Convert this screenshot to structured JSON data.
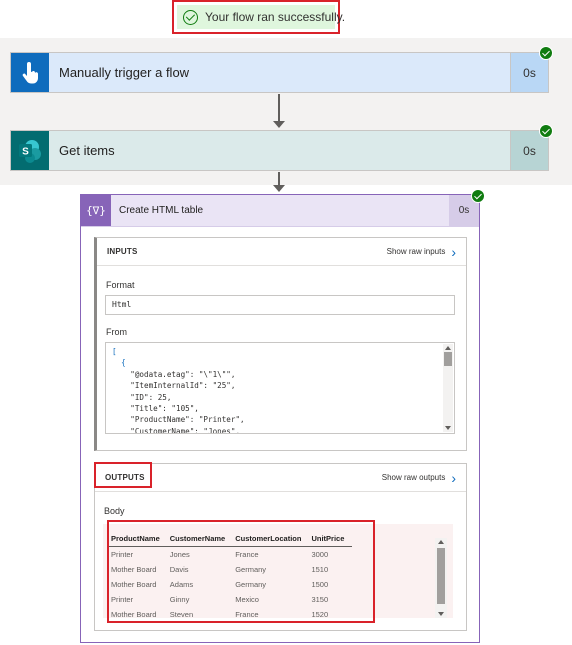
{
  "banner": {
    "text": "Your flow ran successfully."
  },
  "steps": [
    {
      "title": "Manually trigger a flow",
      "duration": "0s",
      "status": "succeeded"
    },
    {
      "title": "Get items",
      "duration": "0s",
      "status": "succeeded",
      "icon_letter": "S"
    }
  ],
  "action": {
    "title": "Create HTML table",
    "icon_text": "{∇}",
    "duration": "0s",
    "inputs": {
      "label": "INPUTS",
      "raw_link": "Show raw inputs",
      "format_label": "Format",
      "format_value": "Html",
      "from_label": "From",
      "from_lines": [
        "[",
        "  {",
        "    \"@odata.etag\": \"\\\"1\\\"\",",
        "    \"ItemInternalId\": \"25\",",
        "    \"ID\": 25,",
        "    \"Title\": \"105\",",
        "    \"ProductName\": \"Printer\",",
        "    \"CustomerName\": \"Jones\","
      ]
    },
    "outputs": {
      "label": "OUTPUTS",
      "raw_link": "Show raw outputs",
      "body_label": "Body",
      "columns": [
        "ProductName",
        "CustomerName",
        "CustomerLocation",
        "UnitPrice"
      ],
      "rows": [
        [
          "Printer",
          "Jones",
          "France",
          "3000"
        ],
        [
          "Mother Board",
          "Davis",
          "Germany",
          "1510"
        ],
        [
          "Mother Board",
          "Adams",
          "Germany",
          "1500"
        ],
        [
          "Printer",
          "Ginny",
          "Mexico",
          "3150"
        ],
        [
          "Mother Board",
          "Steven",
          "France",
          "1520"
        ]
      ]
    }
  },
  "colors": {
    "highlight": "#d9222a",
    "success": "#107c10",
    "action_accent": "#8764b8"
  },
  "icons": {
    "banner": "check-circle-icon",
    "trigger": "touch-hand-icon",
    "sharepoint": "sharepoint-icon",
    "action": "data-operation-icon",
    "raw": "chevron-right-icon",
    "status": "success-check-icon"
  }
}
